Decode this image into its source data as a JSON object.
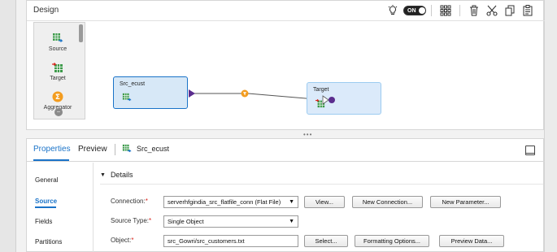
{
  "design": {
    "title": "Design",
    "toggle_label": "ON",
    "palette": [
      {
        "label": "Source",
        "icon": "source-icon"
      },
      {
        "label": "Target",
        "icon": "target-icon"
      },
      {
        "label": "Aggregator",
        "icon": "aggregator-icon"
      }
    ],
    "nodes": {
      "source": {
        "label": "Src_ecust"
      },
      "target": {
        "label": "Target"
      }
    }
  },
  "properties": {
    "tabs": {
      "properties": "Properties",
      "preview": "Preview",
      "object": "Src_ecust"
    },
    "nav": [
      "General",
      "Source",
      "Fields",
      "Partitions"
    ],
    "active_nav": "Source",
    "details_label": "Details",
    "fields": {
      "connection": {
        "label": "Connection:",
        "value": "serverhfgindia_src_flatfile_conn (Flat File)"
      },
      "source_type": {
        "label": "Source Type:",
        "value": "Single Object"
      },
      "object": {
        "label": "Object:",
        "value": "src_Gowri/src_customers.txt"
      }
    },
    "buttons": {
      "view": "View...",
      "new_connection": "New Connection...",
      "new_parameter": "New Parameter...",
      "select": "Select...",
      "formatting_options": "Formatting Options...",
      "preview_data": "Preview Data..."
    }
  },
  "colors": {
    "accent": "#1a73c8",
    "required": "#d9251d",
    "link_node": "#f39c1f",
    "port": "#5b2d8e"
  }
}
